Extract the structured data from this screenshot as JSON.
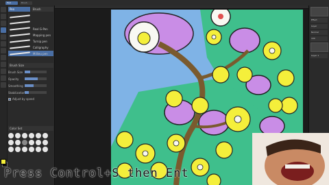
{
  "top_tabs": [
    "Tool",
    "Brush"
  ],
  "brush_tabs": [
    "Pen",
    "Brush"
  ],
  "brushes": [
    {
      "name": "",
      "selected": false
    },
    {
      "name": "",
      "selected": false
    },
    {
      "name": "Real G-Pen",
      "selected": false
    },
    {
      "name": "Mapping pen",
      "selected": false
    },
    {
      "name": "Turnip pen",
      "selected": false
    },
    {
      "name": "Calligraphy",
      "selected": false
    },
    {
      "name": "Millieu pen",
      "selected": true
    }
  ],
  "props": {
    "title": "Brush Size",
    "rows": [
      {
        "label": "Brush Size",
        "value": "",
        "fill": 0.25
      },
      {
        "label": "Opacity",
        "value": "",
        "fill": 0.6
      },
      {
        "label": "Smoothing",
        "value": "",
        "fill": 0.4
      },
      {
        "label": "Stabilization",
        "value": "",
        "fill": 0.2
      }
    ],
    "check_label": "Adjust by speed"
  },
  "palette_title": "Color Set",
  "right_panel": {
    "rows": [
      "Effect",
      "Layer",
      "Normal",
      "100",
      "Layer 1"
    ]
  },
  "caption": "Press Control+S then Ent",
  "colors": {
    "sky": "#7fb3e6",
    "leaf": "#3fbf8c",
    "flower_yellow": "#f4ef3b",
    "flower_purple": "#c98de6",
    "trunk": "#7a5a2e",
    "accent": "#4a6fa5"
  }
}
